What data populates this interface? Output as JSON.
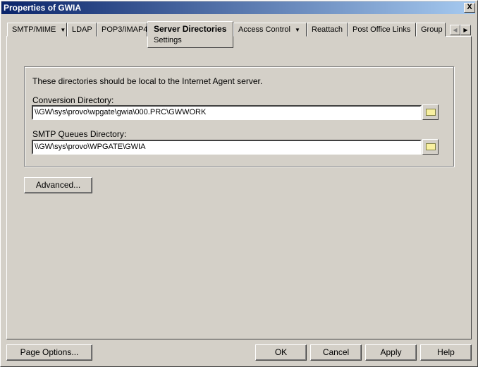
{
  "window": {
    "title": "Properties of GWIA",
    "close": "X"
  },
  "tabs": [
    {
      "label": "SMTP/MIME",
      "dropdown": true
    },
    {
      "label": "LDAP"
    },
    {
      "label": "POP3/IMAP4"
    },
    {
      "label": "Server Directories",
      "sublabel": "Settings",
      "active": true
    },
    {
      "label": "Access Control",
      "dropdown": true
    },
    {
      "label": "Reattach"
    },
    {
      "label": "Post Office Links"
    },
    {
      "label": "Group"
    }
  ],
  "content": {
    "note": "These directories should be local to the Internet Agent server.",
    "conversion_label": "Conversion Directory:",
    "conversion_value": "\\\\GW\\sys\\provo\\wpgate\\gwia\\000.PRC\\GWWORK",
    "smtp_label": "SMTP Queues Directory:",
    "smtp_value": "\\\\GW\\sys\\provo\\WPGATE\\GWIA",
    "advanced": "Advanced..."
  },
  "footer": {
    "page_options": "Page Options...",
    "ok": "OK",
    "cancel": "Cancel",
    "apply": "Apply",
    "help": "Help"
  }
}
